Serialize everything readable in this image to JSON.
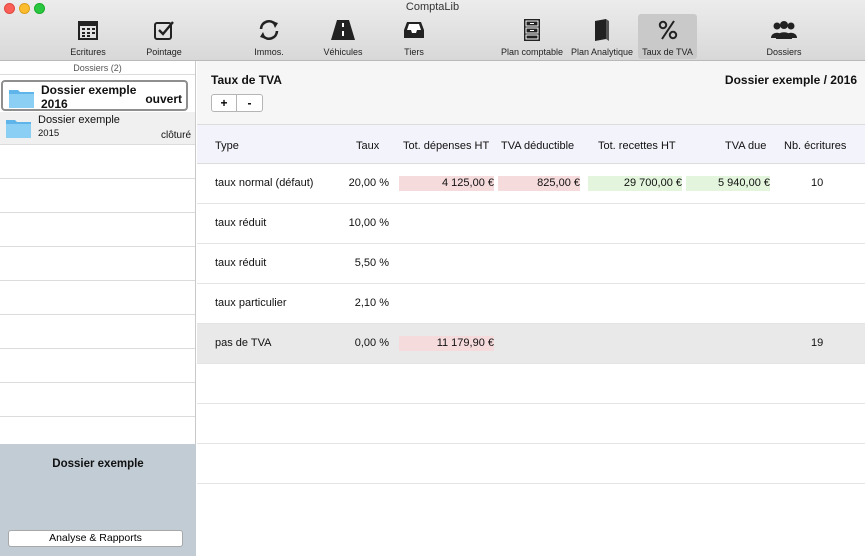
{
  "window": {
    "title": "ComptaLib"
  },
  "toolbar": {
    "ecritures": "Ecritures",
    "pointage": "Pointage",
    "immos": "Immos.",
    "vehicules": "Véhicules",
    "tiers": "Tiers",
    "plan_comptable": "Plan comptable",
    "plan_analytique": "Plan Analytique",
    "taux_tva": "Taux de TVA",
    "dossiers": "Dossiers",
    "active": "taux_tva"
  },
  "sidebar": {
    "header": "Dossiers (2)",
    "dossiers": [
      {
        "name": "Dossier exemple",
        "year": "2016",
        "status": "ouvert"
      },
      {
        "name": "Dossier exemple",
        "year": "2015",
        "status": "clôturé"
      }
    ],
    "bottom_title": "Dossier exemple",
    "rapports_button": "Analyse & Rapports"
  },
  "main": {
    "title": "Taux de TVA",
    "dossier_label": "Dossier exemple / 2016",
    "add_label": "+",
    "remove_label": "-",
    "columns": [
      "Type",
      "Taux",
      "Tot. dépenses HT",
      "TVA déductible",
      "Tot. recettes HT",
      "TVA due",
      "Nb. écritures"
    ],
    "rows": [
      {
        "type": "taux normal (défaut)",
        "taux": "20,00 %",
        "depenses": "4 125,00 €",
        "deductible": "825,00 €",
        "recettes": "29 700,00 €",
        "due": "5 940,00 €",
        "nb": "10"
      },
      {
        "type": "taux réduit",
        "taux": "10,00 %",
        "depenses": "",
        "deductible": "",
        "recettes": "",
        "due": "",
        "nb": ""
      },
      {
        "type": "taux réduit",
        "taux": "5,50 %",
        "depenses": "",
        "deductible": "",
        "recettes": "",
        "due": "",
        "nb": ""
      },
      {
        "type": "taux particulier",
        "taux": "2,10 %",
        "depenses": "",
        "deductible": "",
        "recettes": "",
        "due": "",
        "nb": ""
      },
      {
        "type": "pas de TVA",
        "taux": "0,00 %",
        "depenses": "11 179,90 €",
        "deductible": "",
        "recettes": "",
        "due": "",
        "nb": "19"
      }
    ]
  },
  "colors": {
    "expense_bg": "#f6dbdc",
    "income_bg": "#e3f6dd",
    "sidebar_bottom": "#c2ccd5"
  }
}
